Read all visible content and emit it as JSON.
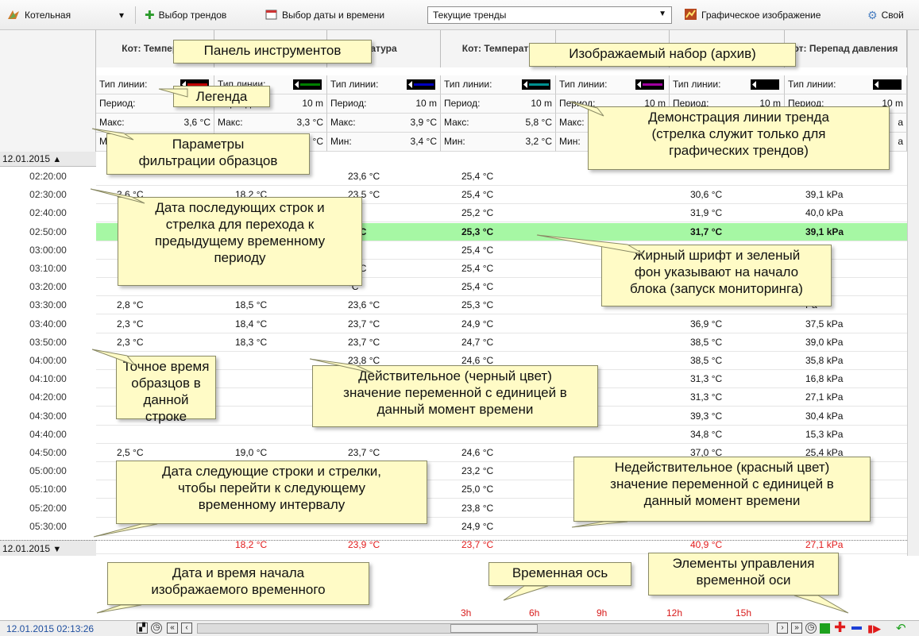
{
  "toolbar": {
    "boiler_label": "Котельная",
    "select_trends_label": "Выбор трендов",
    "select_datetime_label": "Выбор даты и времени",
    "trendset_value": "Текущие тренды",
    "graphic_label": "Графическое изображение",
    "properties_label": "Свой"
  },
  "columns": [
    {
      "title": "Кот: Температ",
      "line_color": "#c00000",
      "period_value": "",
      "max_value": "3,6 °C",
      "min_value": ""
    },
    {
      "title": "",
      "line_color": "#008000",
      "period_value": "10 m",
      "max_value": "3,3 °C",
      "min_value": "°C"
    },
    {
      "title": "атура",
      "line_color": "#0000c0",
      "period_value": "10 m",
      "max_value": "3,9 °C",
      "min_value": "3,4 °C"
    },
    {
      "title": "Кот: Температу",
      "line_color": "#009090",
      "period_value": "10 m",
      "max_value": "5,8 °C",
      "min_value": "3,2 °C"
    },
    {
      "title": "",
      "line_color": "#a000a0",
      "period_value": "10 m",
      "max_value": "",
      "min_value": ""
    },
    {
      "title": "",
      "line_color": "#000000",
      "period_value": "10 m",
      "max_value": "",
      "min_value": ""
    },
    {
      "title": "от: Перепад давления",
      "line_color": "#000000",
      "period_value": "10 m",
      "max_value": "a",
      "min_value": "a"
    }
  ],
  "legend_labels": {
    "line_type": "Тип линии:",
    "period": "Период:",
    "max": "Макс:",
    "min": "Мин:"
  },
  "date_top": "12.01.2015",
  "date_bottom": "12.01.2015",
  "rows": [
    {
      "time": "02:20:00",
      "c1": "",
      "c2": "",
      "c3": "23,6 °C",
      "c4": "25,4 °C",
      "c5": "",
      "c6": "",
      "c7": ""
    },
    {
      "time": "02:30:00",
      "c1": "3,6 °C",
      "c2": "18,2 °C",
      "c3": "23,5 °C",
      "c4": "25,4 °C",
      "c5": "",
      "c6": "30,6 °C",
      "c7": "39,1 kPa"
    },
    {
      "time": "02:40:00",
      "c1": "",
      "c2": "",
      "c3": "°C",
      "c4": "25,2 °C",
      "c5": "",
      "c6": "31,9 °C",
      "c7": "40,0 kPa"
    },
    {
      "time": "02:50:00",
      "c1": "",
      "c2": "",
      "c3": "5 °C",
      "c4": "25,3 °C",
      "c5": "",
      "c6": "31,7 °C",
      "c7": "39,1 kPa",
      "highlight": true
    },
    {
      "time": "03:00:00",
      "c1": "",
      "c2": "",
      "c3": "°C",
      "c4": "25,4 °C",
      "c5": "",
      "c6": "",
      "c7": "Pa"
    },
    {
      "time": "03:10:00",
      "c1": "",
      "c2": "",
      "c3": "5 °C",
      "c4": "25,4 °C",
      "c5": "",
      "c6": "",
      "c7": "Pa"
    },
    {
      "time": "03:20:00",
      "c1": "",
      "c2": "",
      "c3": "°C",
      "c4": "25,4 °C",
      "c5": "",
      "c6": "",
      "c7": "Pa"
    },
    {
      "time": "03:30:00",
      "c1": "2,8 °C",
      "c2": "18,5 °C",
      "c3": "23,6 °C",
      "c4": "25,3 °C",
      "c5": "",
      "c6": "",
      "c7": "Pa"
    },
    {
      "time": "03:40:00",
      "c1": "2,3 °C",
      "c2": "18,4 °C",
      "c3": "23,7 °C",
      "c4": "24,9 °C",
      "c5": "",
      "c6": "36,9 °C",
      "c7": "37,5 kPa"
    },
    {
      "time": "03:50:00",
      "c1": "2,3 °C",
      "c2": "18,3 °C",
      "c3": "23,7 °C",
      "c4": "24,7 °C",
      "c5": "",
      "c6": "38,5 °C",
      "c7": "39,0 kPa"
    },
    {
      "time": "04:00:00",
      "c1": "",
      "c2": "",
      "c3": "23,8 °C",
      "c4": "24,6 °C",
      "c5": "",
      "c6": "38,5 °C",
      "c7": "35,8 kPa"
    },
    {
      "time": "04:10:00",
      "c1": "",
      "c2": "",
      "c3": "",
      "c4": "",
      "c5": "",
      "c6": "31,3 °C",
      "c7": "16,8 kPa"
    },
    {
      "time": "04:20:00",
      "c1": "",
      "c2": "",
      "c3": "",
      "c4": "",
      "c5": "",
      "c6": "31,3 °C",
      "c7": "27,1 kPa"
    },
    {
      "time": "04:30:00",
      "c1": "",
      "c2": "",
      "c3": "",
      "c4": "",
      "c5": "",
      "c6": "39,3 °C",
      "c7": "30,4 kPa"
    },
    {
      "time": "04:40:00",
      "c1": "",
      "c2": "",
      "c3": "",
      "c4": "",
      "c5": "",
      "c6": "34,8 °C",
      "c7": "15,3 kPa"
    },
    {
      "time": "04:50:00",
      "c1": "2,5 °C",
      "c2": "19,0 °C",
      "c3": "23,7 °C",
      "c4": "24,6 °C",
      "c5": "",
      "c6": "37,0 °C",
      "c7": "25,4 kPa"
    },
    {
      "time": "05:00:00",
      "c1": "",
      "c2": "",
      "c3": "",
      "c4": "23,2 °C",
      "c5": "",
      "c6": "",
      "c7": ""
    },
    {
      "time": "05:10:00",
      "c1": "",
      "c2": "",
      "c3": "",
      "c4": "25,0 °C",
      "c5": "",
      "c6": "",
      "c7": ""
    },
    {
      "time": "05:20:00",
      "c1": "",
      "c2": "",
      "c3": "",
      "c4": "23,8 °C",
      "c5": "",
      "c6": "",
      "c7": ""
    },
    {
      "time": "05:30:00",
      "c1": "",
      "c2": "",
      "c3": "",
      "c4": "24,9 °C",
      "c5": "",
      "c6": "",
      "c7": ""
    },
    {
      "time": "05:40:00",
      "c1": "",
      "c2": "18,2 °C",
      "c3": "23,9 °C",
      "c4": "23,7 °C",
      "c5": "",
      "c6": "40,9 °C",
      "c7": "27,1 kPa",
      "invalid": true
    }
  ],
  "axis": {
    "ticks": [
      "3h",
      "6h",
      "9h",
      "12h",
      "15h"
    ]
  },
  "status": {
    "datetime": "12.01.2015 02:13:26"
  },
  "callouts": {
    "toolbar": "Панель инструментов",
    "displayed_set": "Изображаемый набор (архив)",
    "legend": "Легенда",
    "trend_line_demo": "Демонстрация линии тренда\n(стрелка служит только для\nграфических трендов)",
    "filter_params": "Параметры\nфильтрации образцов",
    "date_next_rows": "Дата последующих строк и\nстрелка для перехода к\nпредыдущему временному\nпериоду",
    "bold_green": "Жирный шрифт и зеленый\nфон указывают на начало\nблока (запуск мониторинга)",
    "exact_time": "Точное время\nобразцов в\nданной строке",
    "valid_value": "Действительное (черный цвет)\nзначение переменной с единицей в\nданный момент времени",
    "date_next_interval": "Дата следующие строки и стрелки,\nчтобы перейти к следующему\nвременному интервалу",
    "invalid_value": "Недействительное (красный цвет)\nзначение переменной с единицей в\nданный момент времени",
    "start_datetime": "Дата и время начала\nизображаемого временного",
    "time_axis": "Временная ось",
    "axis_controls": "Элементы управления\nвременной оси"
  }
}
